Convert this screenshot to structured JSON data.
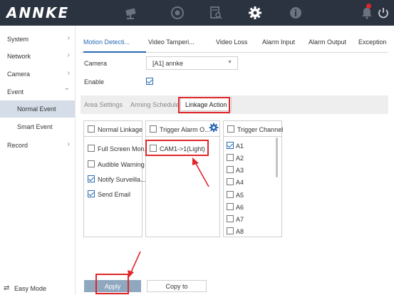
{
  "app": {
    "logo": "ANNKE"
  },
  "topbar": {
    "icons": [
      "camera-icon",
      "playback-icon",
      "search-file-icon",
      "gear-icon",
      "info-icon",
      "bell-icon",
      "power-icon"
    ],
    "active_icon": "gear-icon",
    "notification_dot_color": "#e0262b"
  },
  "sidebar": {
    "items": [
      {
        "label": "System",
        "chevron": "›"
      },
      {
        "label": "Network",
        "chevron": "›"
      },
      {
        "label": "Camera",
        "chevron": "›"
      },
      {
        "label": "Event",
        "chevron": "⌄"
      },
      {
        "label": "Record",
        "chevron": "›"
      }
    ],
    "sub_items": [
      {
        "label": "Normal Event",
        "active": true
      },
      {
        "label": "Smart Event",
        "active": false
      }
    ],
    "easy_mode": {
      "label": "Easy Mode",
      "icon": "⇄"
    }
  },
  "main": {
    "tabs": [
      {
        "label": "Motion Detecti...",
        "active": true
      },
      {
        "label": "Video Tamperi..."
      },
      {
        "label": "Video Loss"
      },
      {
        "label": "Alarm Input"
      },
      {
        "label": "Alarm Output"
      },
      {
        "label": "Exception"
      }
    ],
    "camera_label": "Camera",
    "camera_value": "[A1] annke",
    "camera_arrow": "▼",
    "enable_label": "Enable",
    "enable_checked": true,
    "subtabs": [
      {
        "label": "Area Settings"
      },
      {
        "label": "Arming Schedule"
      },
      {
        "label": "Linkage Action",
        "active": true
      }
    ],
    "normal_linkage": {
      "header": "Normal Linkage",
      "items": [
        {
          "label": "Full Screen Mon...",
          "checked": false
        },
        {
          "label": "Audible Warning",
          "checked": false
        },
        {
          "label": "Notify Surveilla...",
          "checked": true
        },
        {
          "label": "Send Email",
          "checked": true
        }
      ]
    },
    "trigger_alarm": {
      "header": "Trigger Alarm O...",
      "items": [
        {
          "label": "CAM1->1(Light)",
          "checked": false
        }
      ]
    },
    "trigger_channel": {
      "header": "Trigger Channel",
      "items": [
        {
          "label": "A1",
          "checked": true
        },
        {
          "label": "A2",
          "checked": false
        },
        {
          "label": "A3",
          "checked": false
        },
        {
          "label": "A4",
          "checked": false
        },
        {
          "label": "A5",
          "checked": false
        },
        {
          "label": "A6",
          "checked": false
        },
        {
          "label": "A7",
          "checked": false
        },
        {
          "label": "A8",
          "checked": false
        }
      ]
    },
    "buttons": {
      "apply": "Apply",
      "copy_to": "Copy to"
    }
  },
  "colors": {
    "topbar_bg": "#2c3340",
    "accent": "#2a6bb3",
    "active_sidebar": "#d4dde8",
    "annotation_red": "#e0262b",
    "apply_button": "#8fa8c0"
  }
}
